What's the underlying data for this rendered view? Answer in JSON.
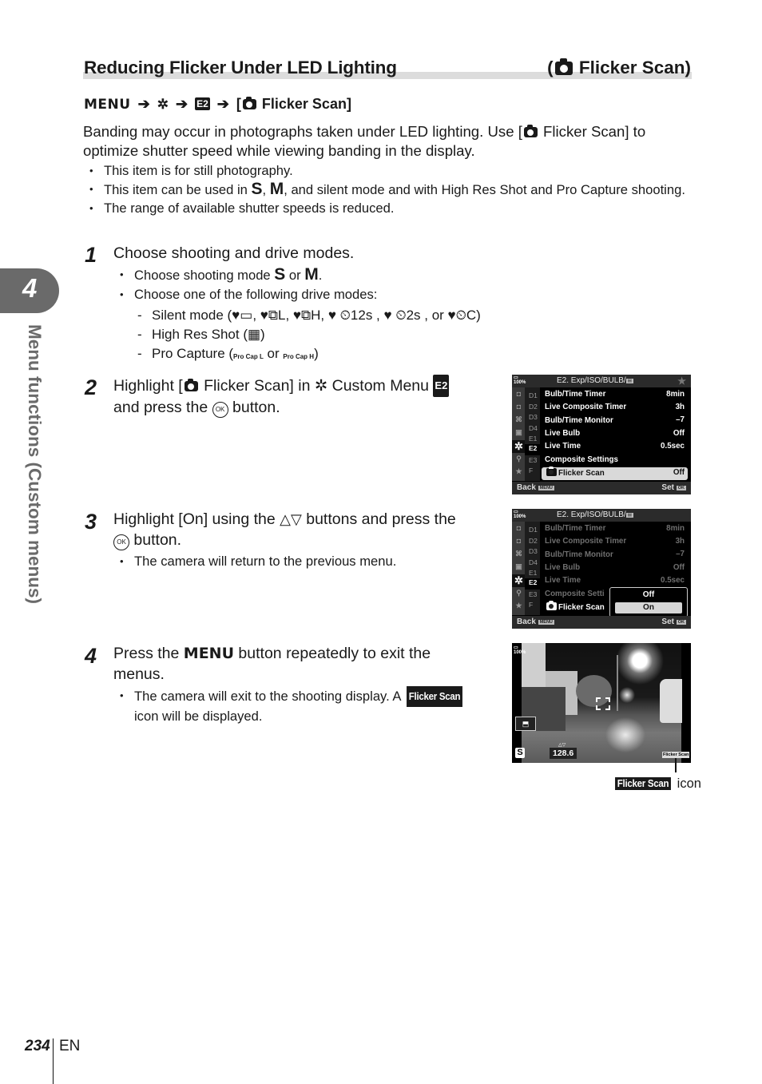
{
  "section": {
    "title": "Reducing Flicker Under LED Lighting",
    "title_right": "Flicker Scan)",
    "title_right_open": "(",
    "icon": "camera-icon"
  },
  "menu_path": {
    "menu": "MENU",
    "arrow": "➔",
    "custom_icon": "gear-icon",
    "tab": "E2",
    "item": "Flicker Scan]",
    "item_open": "["
  },
  "intro": {
    "line1_a": "Banding may occur in photographs taken under LED lighting. Use [",
    "line1_b": " Flicker Scan] to optimize shutter speed while viewing banding in the display.",
    "bullets": [
      "This item is for still photography.",
      "The range of available shutter speeds is reduced."
    ],
    "bullet2": {
      "a": "This item can be used in ",
      "s": "S",
      "comma": ", ",
      "m": "M",
      "b": ", and silent mode and with High Res Shot and Pro Capture shooting."
    }
  },
  "steps": [
    {
      "number": "1",
      "title": "Choose shooting and drive modes.",
      "sub1_a": "Choose shooting mode ",
      "sub1_s": "S",
      "sub1_or": " or ",
      "sub1_m": "M",
      "sub1_end": ".",
      "sub2": "Choose one of the following drive modes:",
      "dash1": "Silent mode (♥▭, ♥⧉L, ♥⧉H, ♥ ⏲12s , ♥ ⏲2s , or ♥⏲C)",
      "dash2": "High Res Shot (▦)",
      "dash3_a": "Pro Capture (",
      "dash3_or": " or ",
      "dash3_b": ")",
      "pro_l": "Pro Cap L",
      "pro_h": "Pro Cap H"
    },
    {
      "number": "2",
      "title_a": "Highlight [",
      "title_b": " Flicker Scan] in ",
      "title_c": " Custom Menu ",
      "title_tab": "E2",
      "title_d": "and press the ",
      "title_ok": "OK",
      "title_e": " button."
    },
    {
      "number": "3",
      "title_a": "Highlight [On] using the ",
      "tri": "△▽",
      "title_b": " buttons and press the",
      "title_ok": "OK",
      "title_c": " button.",
      "sub1": "The camera will return to the previous menu."
    },
    {
      "number": "4",
      "title_a": "Press the ",
      "title_menu": "MENU",
      "title_b": " button repeatedly to exit the menus.",
      "sub1_a": "The camera will exit to the shooting display. A ",
      "sub1_badge": "Flicker Scan",
      "sub1_b": "icon will be displayed."
    }
  ],
  "camera_menu": {
    "battery": "100%",
    "title": "E2. Exp/ISO/BULB/",
    "tabs": [
      "D1",
      "D2",
      "D3",
      "D4",
      "E1",
      "E2",
      "E3",
      "F"
    ],
    "selected_tab": "E2",
    "rows": [
      {
        "label": "Bulb/Time Timer",
        "value": "8min"
      },
      {
        "label": "Live Composite Timer",
        "value": "3h"
      },
      {
        "label": "Bulb/Time Monitor",
        "value": "–7"
      },
      {
        "label": "Live Bulb",
        "value": "Off"
      },
      {
        "label": "Live Time",
        "value": "0.5sec"
      },
      {
        "label": "Composite Settings",
        "value": ""
      },
      {
        "label": "Flicker Scan",
        "value": "Off"
      }
    ],
    "back_label": "Back",
    "back_tag": "MENU",
    "set_label": "Set",
    "set_tag": "OK"
  },
  "camera_menu2": {
    "truncated_label": "Composite Setti",
    "options": [
      "Off",
      "On"
    ],
    "selected": "On"
  },
  "live_view": {
    "battery": "100%",
    "mode": "S",
    "shutter_value": "128.6",
    "flicker_badge": "Flicker Scan",
    "callout_badge": "Flicker Scan",
    "callout_text": "icon"
  },
  "side_tab": {
    "chapter": "4",
    "label": "Menu functions (Custom menus)"
  },
  "footer": {
    "page": "234",
    "lang": "EN"
  }
}
